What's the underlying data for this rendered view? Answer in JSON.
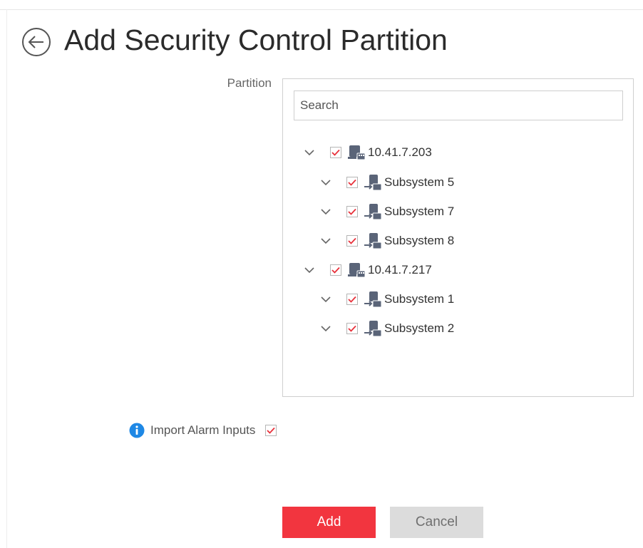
{
  "header": {
    "title": "Add Security Control Partition",
    "back_icon": "arrow-left-circle-icon"
  },
  "form": {
    "partition_label": "Partition",
    "search": {
      "placeholder": "Search",
      "value": ""
    },
    "tree": [
      {
        "label": "10.41.7.203",
        "type": "device",
        "checked": true,
        "expanded": true,
        "icon": "device-icon",
        "children": [
          {
            "label": "Subsystem 5",
            "type": "subsystem",
            "checked": true,
            "expanded": true,
            "icon": "subsystem-icon"
          },
          {
            "label": "Subsystem 7",
            "type": "subsystem",
            "checked": true,
            "expanded": true,
            "icon": "subsystem-icon"
          },
          {
            "label": "Subsystem 8",
            "type": "subsystem",
            "checked": true,
            "expanded": true,
            "icon": "subsystem-icon"
          }
        ]
      },
      {
        "label": "10.41.7.217",
        "type": "device",
        "checked": true,
        "expanded": true,
        "icon": "device-icon",
        "children": [
          {
            "label": "Subsystem 1",
            "type": "subsystem",
            "checked": true,
            "expanded": true,
            "icon": "subsystem-icon"
          },
          {
            "label": "Subsystem 2",
            "type": "subsystem",
            "checked": true,
            "expanded": true,
            "icon": "subsystem-icon"
          }
        ]
      }
    ],
    "import_alarm_inputs": {
      "label": "Import Alarm Inputs",
      "checked": true,
      "icon": "info-icon"
    }
  },
  "actions": {
    "add_label": "Add",
    "cancel_label": "Cancel"
  },
  "colors": {
    "accent": "#f2353f",
    "checkmark": "#e8303a",
    "info": "#1e88e5",
    "node_icon": "#5a6478"
  }
}
